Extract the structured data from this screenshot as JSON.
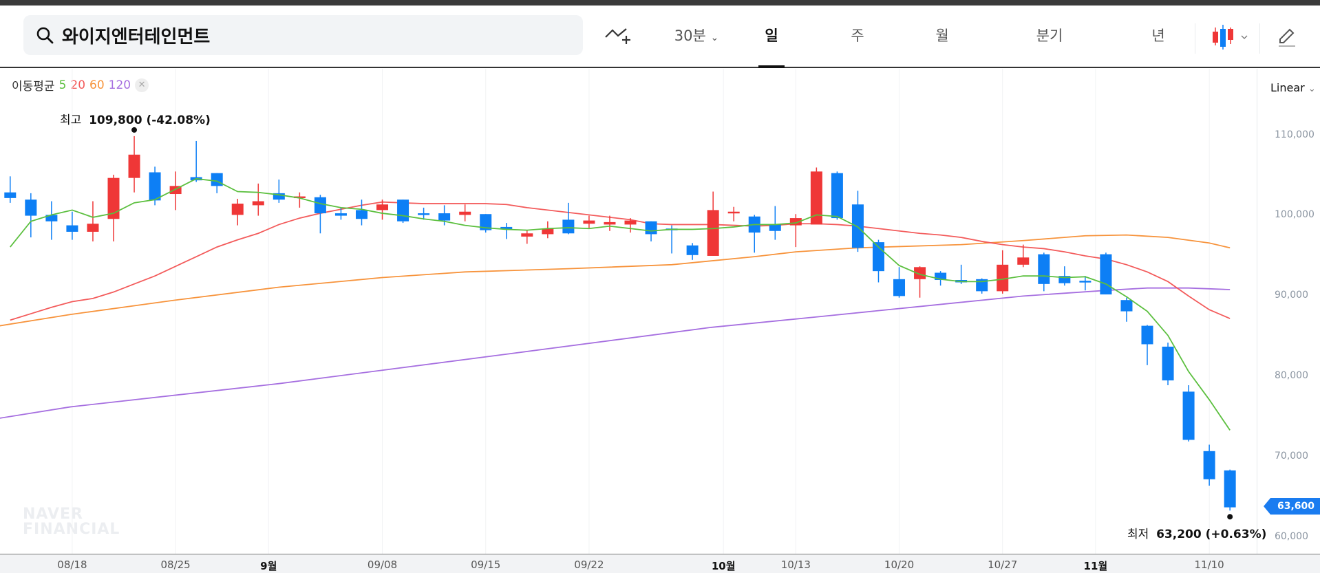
{
  "header": {
    "search_text": "와이지엔터테인먼트",
    "interval": "30분",
    "tabs": [
      "일",
      "주",
      "월",
      "분기",
      "년"
    ],
    "active_tab": "일"
  },
  "legend": {
    "title": "이동평균",
    "ma": [
      "5",
      "20",
      "60",
      "120"
    ]
  },
  "scale_mode": "Linear",
  "high_label": {
    "prefix": "최고",
    "value": "109,800 (-42.08%)"
  },
  "low_label": {
    "prefix": "최저",
    "value": "63,200 (+0.63%)"
  },
  "last_price": "63,600",
  "watermark": [
    "NAVER",
    "FINANCIAL"
  ],
  "colors": {
    "up": "#ef3737",
    "down": "#0d7ff5",
    "ma5": "#5bbf3e",
    "ma20": "#f35b5b",
    "ma60": "#f7933b",
    "ma120": "#a66fe0"
  },
  "chart_data": {
    "type": "candlestick",
    "y_ticks": [
      "110,000",
      "100,000",
      "90,000",
      "80,000",
      "70,000",
      "60,000"
    ],
    "y_tick_values": [
      110000,
      100000,
      90000,
      80000,
      70000,
      60000
    ],
    "x_labels": [
      [
        "08/18",
        4,
        false
      ],
      [
        "08/25",
        9,
        false
      ],
      [
        "9월",
        13.5,
        true
      ],
      [
        "09/08",
        19,
        false
      ],
      [
        "09/15",
        24,
        false
      ],
      [
        "09/22",
        29,
        false
      ],
      [
        "10월",
        35.5,
        true
      ],
      [
        "10/13",
        39,
        false
      ],
      [
        "10/20",
        44,
        false
      ],
      [
        "10/27",
        49,
        false
      ],
      [
        "11월",
        53.5,
        true
      ],
      [
        "11/10",
        59,
        false
      ]
    ],
    "candles_ohlc": [
      [
        102800,
        104800,
        101500,
        102100
      ],
      [
        101900,
        102700,
        97200,
        99900
      ],
      [
        100000,
        101700,
        96900,
        99200
      ],
      [
        98700,
        100400,
        96900,
        97900
      ],
      [
        97900,
        101700,
        96700,
        98900
      ],
      [
        99500,
        105000,
        96700,
        104600
      ],
      [
        104600,
        109800,
        102800,
        107500
      ],
      [
        105300,
        106000,
        101200,
        101800
      ],
      [
        102600,
        105400,
        100600,
        103600
      ],
      [
        104700,
        109200,
        104100,
        104300
      ],
      [
        105200,
        105200,
        102700,
        103600
      ],
      [
        100000,
        102000,
        98700,
        101400
      ],
      [
        101200,
        103900,
        99900,
        101700
      ],
      [
        102700,
        104400,
        101500,
        101900
      ],
      [
        102100,
        102800,
        100900,
        102300
      ],
      [
        102200,
        102500,
        97700,
        100200
      ],
      [
        100200,
        100900,
        99400,
        99900
      ],
      [
        100600,
        101900,
        98700,
        99500
      ],
      [
        100600,
        101900,
        99400,
        101300
      ],
      [
        101900,
        101900,
        99000,
        99200
      ],
      [
        100200,
        100900,
        99400,
        100000
      ],
      [
        100200,
        101200,
        98700,
        99300
      ],
      [
        100000,
        101300,
        99200,
        100400
      ],
      [
        100100,
        100100,
        97800,
        98100
      ],
      [
        98500,
        99000,
        97000,
        98200
      ],
      [
        97300,
        98100,
        96400,
        97700
      ],
      [
        97600,
        99200,
        97100,
        98300
      ],
      [
        99400,
        101500,
        97600,
        97700
      ],
      [
        98900,
        99900,
        98300,
        99300
      ],
      [
        98800,
        99900,
        98000,
        99100
      ],
      [
        98800,
        99600,
        97800,
        99300
      ],
      [
        99200,
        99200,
        96700,
        97600
      ],
      [
        98300,
        98700,
        95200,
        98100
      ],
      [
        96200,
        96500,
        94400,
        95000
      ],
      [
        94900,
        102900,
        94900,
        100600
      ],
      [
        100200,
        101000,
        99200,
        100400
      ],
      [
        99800,
        100000,
        95300,
        97800
      ],
      [
        98800,
        101100,
        96900,
        98000
      ],
      [
        98700,
        100100,
        96000,
        99600
      ],
      [
        98800,
        105900,
        99000,
        105400
      ],
      [
        105200,
        105400,
        99400,
        99600
      ],
      [
        101300,
        103000,
        95400,
        95900
      ],
      [
        96600,
        96900,
        91600,
        93000
      ],
      [
        92000,
        93500,
        89700,
        89900
      ],
      [
        92000,
        93600,
        89700,
        93500
      ],
      [
        92800,
        93000,
        91200,
        91900
      ],
      [
        91900,
        93800,
        91400,
        91600
      ],
      [
        92000,
        92100,
        90200,
        90500
      ],
      [
        90500,
        95600,
        90200,
        93800
      ],
      [
        93800,
        96300,
        93500,
        94700
      ],
      [
        95100,
        95300,
        90500,
        91400
      ],
      [
        92400,
        93600,
        91200,
        91500
      ],
      [
        91800,
        92400,
        90600,
        91600
      ],
      [
        95100,
        95300,
        90100,
        90100
      ],
      [
        89400,
        89700,
        86700,
        88000
      ],
      [
        86200,
        86300,
        81300,
        83900
      ],
      [
        83600,
        84100,
        78800,
        79400
      ],
      [
        78000,
        78800,
        71800,
        72000
      ],
      [
        70600,
        71400,
        66300,
        67100
      ],
      [
        68200,
        68300,
        63200,
        63600
      ]
    ],
    "ma5": [
      96000,
      99200,
      100000,
      100600,
      99700,
      100200,
      101500,
      101900,
      103200,
      104500,
      104200,
      102900,
      102800,
      102500,
      102100,
      101400,
      100900,
      100700,
      100200,
      99900,
      99500,
      99200,
      98700,
      98400,
      98200,
      98100,
      98300,
      98400,
      98300,
      98600,
      98300,
      98000,
      98200,
      98200,
      98300,
      98500,
      98800,
      98800,
      99000,
      100000,
      99800,
      98500,
      96000,
      93700,
      92600,
      92000,
      91700,
      91700,
      92000,
      92400,
      92400,
      92200,
      92300,
      91400,
      89800,
      88000,
      85000,
      80500,
      77000,
      73200
    ],
    "ma20": [
      86900,
      87700,
      88500,
      89200,
      89600,
      90400,
      91400,
      92400,
      93600,
      94800,
      96000,
      96900,
      97700,
      98800,
      99600,
      100200,
      100700,
      101200,
      101600,
      101500,
      101400,
      101400,
      101400,
      101400,
      101300,
      100900,
      100600,
      100300,
      100000,
      99700,
      99400,
      98900,
      98800,
      98800,
      98800,
      98700,
      98600,
      98700,
      98900,
      98900,
      98800,
      98600,
      98300,
      98000,
      97700,
      97500,
      97200,
      96700,
      96300,
      96000,
      95800,
      95400,
      94900,
      94500,
      93800,
      92900,
      91700,
      89900,
      88200,
      87100
    ],
    "ma60_points": [
      [
        0.5,
        86200
      ],
      [
        3.9,
        87600
      ],
      [
        9,
        89400
      ],
      [
        14,
        91000
      ],
      [
        19,
        92200
      ],
      [
        23,
        92900
      ],
      [
        28,
        93300
      ],
      [
        33,
        93800
      ],
      [
        37,
        94800
      ],
      [
        39,
        95400
      ],
      [
        42,
        95900
      ],
      [
        47,
        96300
      ],
      [
        50,
        96800
      ],
      [
        53,
        97400
      ],
      [
        55,
        97500
      ],
      [
        57,
        97200
      ],
      [
        59,
        96500
      ],
      [
        60,
        95900
      ]
    ],
    "ma120_points": [
      [
        0.5,
        74700
      ],
      [
        3.9,
        76100
      ],
      [
        14,
        79000
      ],
      [
        25.1,
        82700
      ],
      [
        34.9,
        86000
      ],
      [
        40,
        87300
      ],
      [
        45,
        88600
      ],
      [
        50,
        89900
      ],
      [
        54,
        90600
      ],
      [
        56,
        90900
      ],
      [
        58,
        90900
      ],
      [
        60,
        90700
      ]
    ],
    "high": {
      "index": 7,
      "value": 109800
    },
    "low": {
      "index": 60,
      "value": 63200
    }
  }
}
